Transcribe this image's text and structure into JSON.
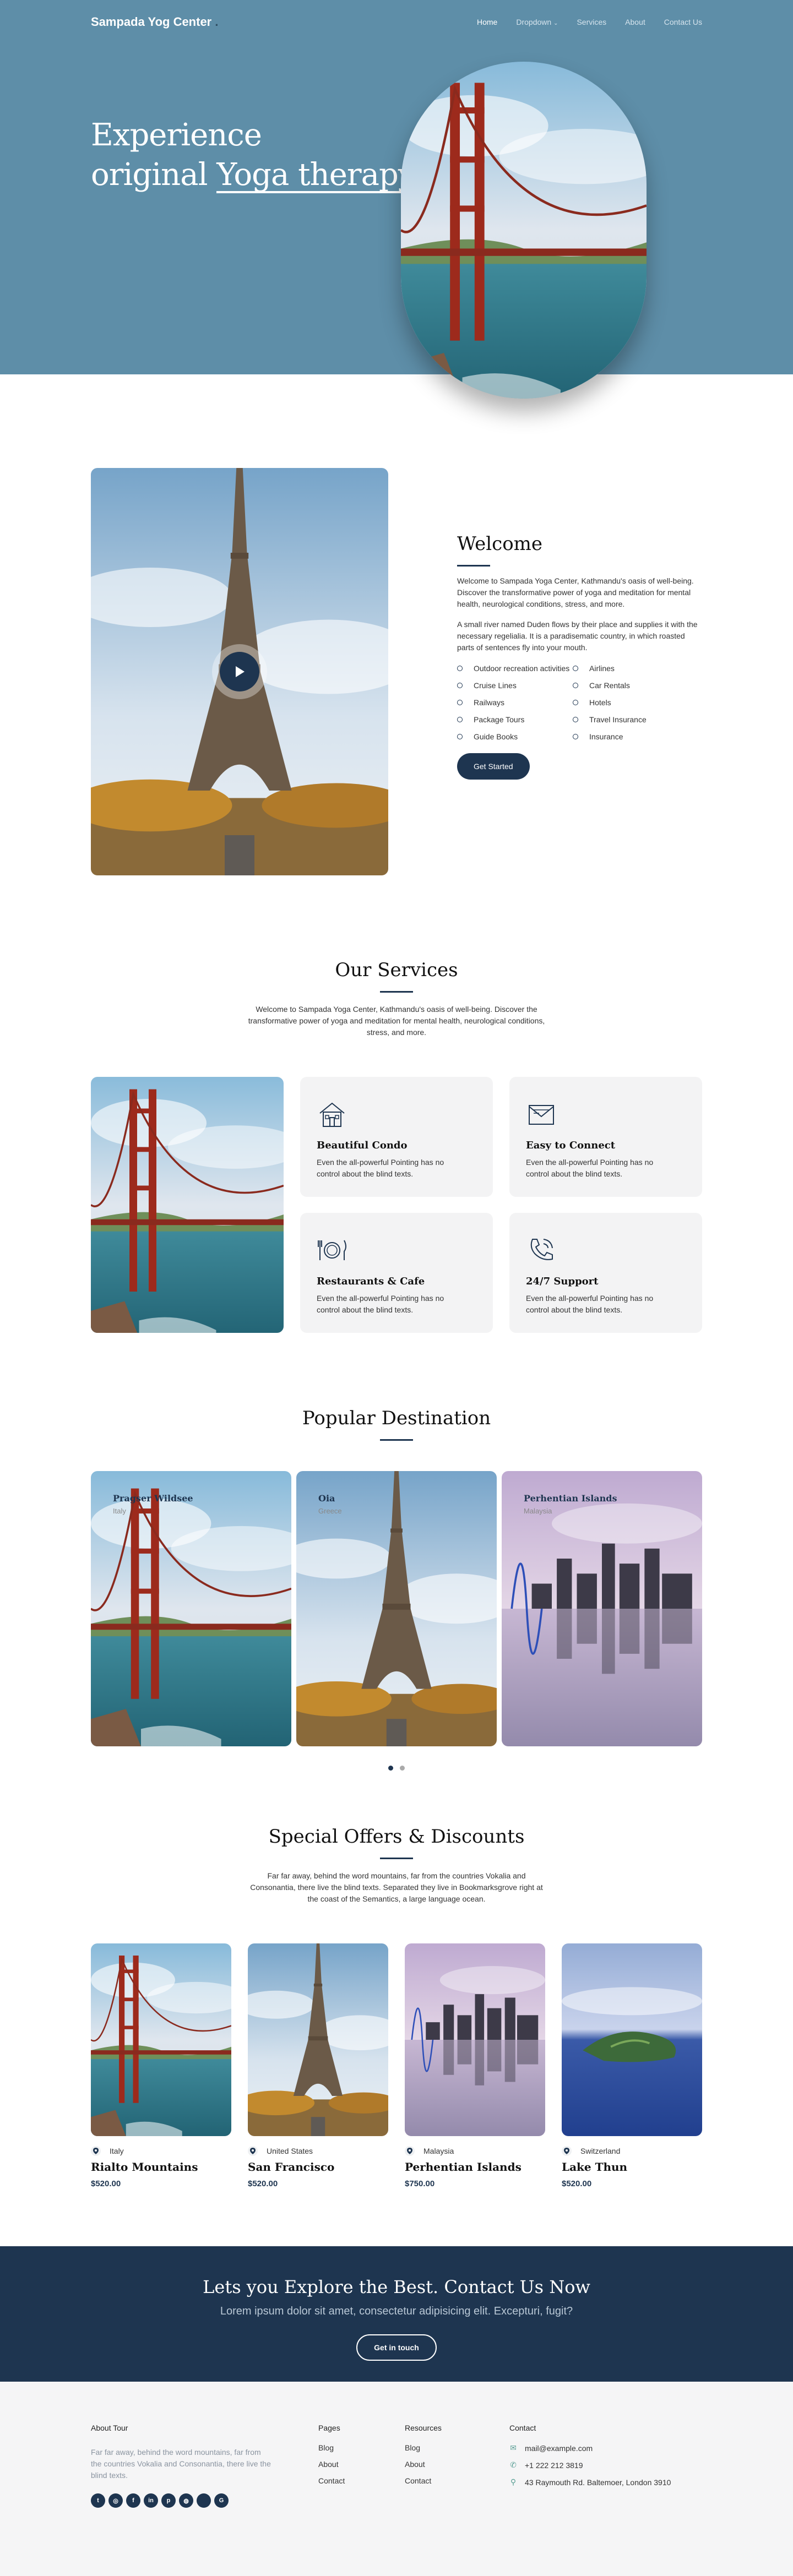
{
  "brand": {
    "name": "Sampada Yog Center",
    "dot": "."
  },
  "nav": {
    "home": "Home",
    "dropdown": "Dropdown",
    "services": "Services",
    "about": "About",
    "contact": "Contact Us"
  },
  "hero": {
    "line1": "Experience",
    "line2a": "original",
    "line2b": "Yoga therapy"
  },
  "welcome": {
    "title": "Welcome",
    "p1": "Welcome to Sampada Yoga Center, Kathmandu's oasis of well-being. Discover the transformative power of yoga and meditation for mental health, neurological conditions, stress, and more.",
    "p2": "A small river named Duden flows by their place and supplies it with the necessary regelialia. It is a paradisematic country, in which roasted parts of sentences fly into your mouth.",
    "list_left": [
      "Outdoor recreation activities",
      "Cruise Lines",
      "Railways",
      "Package Tours",
      "Guide Books"
    ],
    "list_right": [
      "Airlines",
      "Car Rentals",
      "Hotels",
      "Travel Insurance",
      "Insurance"
    ],
    "button": "Get Started"
  },
  "services": {
    "title": "Our Services",
    "intro": "Welcome to Sampada Yoga Center, Kathmandu's oasis of well-being. Discover the transformative power of yoga and meditation for mental health, neurological conditions, stress, and more.",
    "cards": [
      {
        "title": "Beautiful Condo",
        "text": "Even the all-powerful Pointing has no control about the blind texts.",
        "icon": "house-icon"
      },
      {
        "title": "Easy to Connect",
        "text": "Even the all-powerful Pointing has no control about the blind texts.",
        "icon": "mail-icon"
      },
      {
        "title": "Restaurants & Cafe",
        "text": "Even the all-powerful Pointing has no control about the blind texts.",
        "icon": "dining-icon"
      },
      {
        "title": "24/7 Support",
        "text": "Even the all-powerful Pointing has no control about the blind texts.",
        "icon": "phone-icon"
      }
    ]
  },
  "destinations": {
    "title": "Popular Destination",
    "items": [
      {
        "name": "Pragser Wildsee",
        "country": "Italy"
      },
      {
        "name": "Oia",
        "country": "Greece"
      },
      {
        "name": "Perhentian Islands",
        "country": "Malaysia"
      }
    ]
  },
  "offers": {
    "title": "Special Offers & Discounts",
    "intro": "Far far away, behind the word mountains, far from the countries Vokalia and Consonantia, there live the blind texts. Separated they live in Bookmarksgrove right at the coast of the Semantics, a large language ocean.",
    "items": [
      {
        "country": "Italy",
        "name": "Rialto Mountains",
        "price": "$520.00"
      },
      {
        "country": "United States",
        "name": "San Francisco",
        "price": "$520.00"
      },
      {
        "country": "Malaysia",
        "name": "Perhentian Islands",
        "price": "$750.00"
      },
      {
        "country": "Switzerland",
        "name": "Lake Thun",
        "price": "$520.00"
      }
    ]
  },
  "cta": {
    "title": "Lets you Explore the Best. Contact Us Now",
    "sub": "Lorem ipsum dolor sit amet, consectetur adipisicing elit. Excepturi, fugit?",
    "button": "Get in touch"
  },
  "footer": {
    "about_title": "About Tour",
    "about_text": "Far far away, behind the word mountains, far from the countries Vokalia and Consonantia, there live the blind texts.",
    "pages_title": "Pages",
    "pages": [
      "Blog",
      "About",
      "Contact"
    ],
    "resources_title": "Resources",
    "resources": [
      "Blog",
      "About",
      "Contact"
    ],
    "contact_title": "Contact",
    "email": "mail@example.com",
    "phone": "+1 222 212 3819",
    "address": "43 Raymouth Rd. Baltemoer, London 3910",
    "socials": [
      "twitter-icon",
      "instagram-icon",
      "facebook-icon",
      "linkedin-icon",
      "pinterest-icon",
      "dribbble-icon",
      "apple-icon",
      "google-icon"
    ]
  },
  "colors": {
    "hero_bg": "#5e8ea8",
    "navy": "#1e3550",
    "card_bg": "#f3f3f4"
  }
}
